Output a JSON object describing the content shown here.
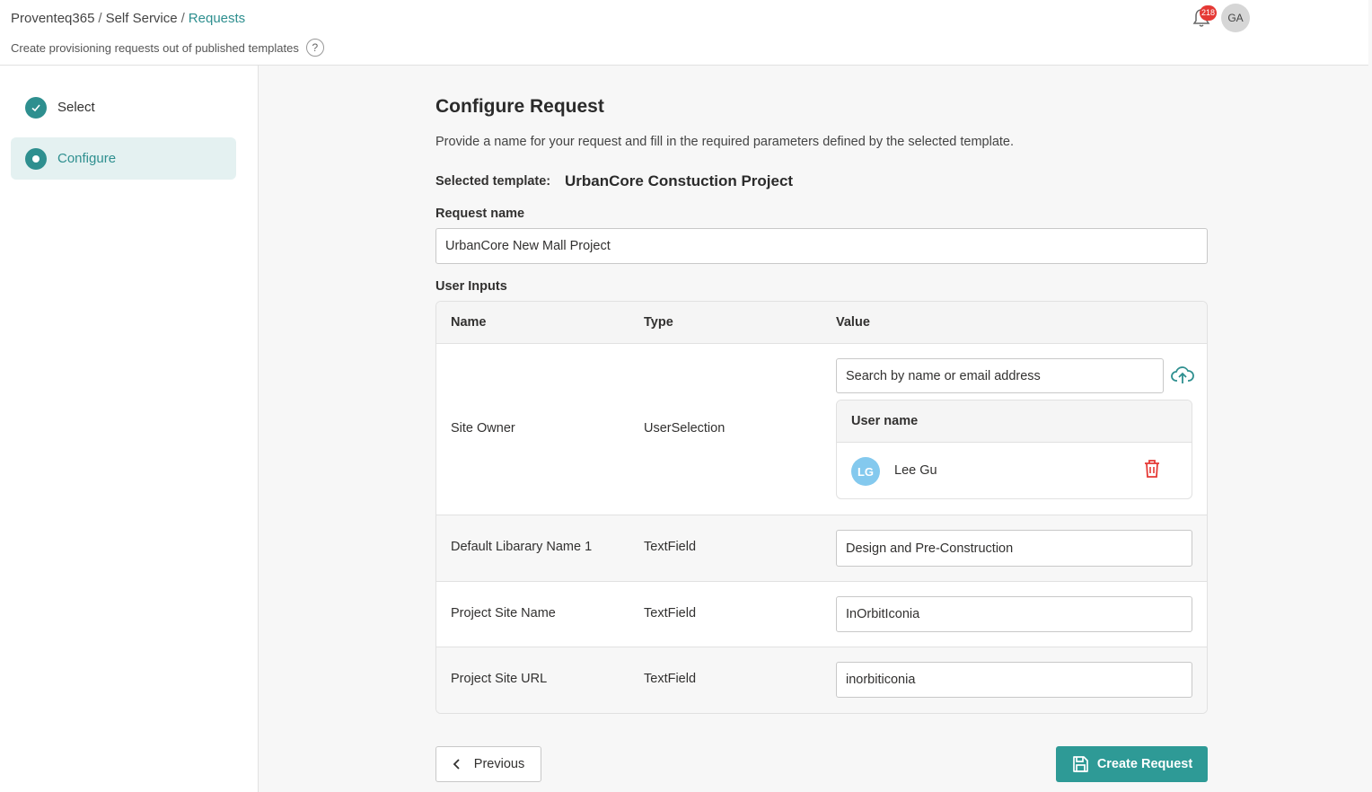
{
  "header": {
    "breadcrumb": [
      "Proventeq365",
      "Self Service",
      "Requests"
    ],
    "subtitle": "Create provisioning requests out of published templates",
    "help_icon": "?",
    "notification_count": "218",
    "user_initials": "GA"
  },
  "sidebar": {
    "steps": [
      {
        "label": "Select",
        "state": "completed"
      },
      {
        "label": "Configure",
        "state": "active"
      }
    ]
  },
  "main": {
    "title": "Configure Request",
    "description": "Provide a name for your request and fill in the required parameters defined by the selected template.",
    "selected_template_label": "Selected template:",
    "selected_template_value": "UrbanCore Constuction Project",
    "request_name_label": "Request name",
    "request_name_value": "UrbanCore New Mall Project",
    "user_inputs_label": "User Inputs",
    "table": {
      "headers": [
        "Name",
        "Type",
        "Value"
      ],
      "site_owner": {
        "name": "Site Owner",
        "type": "UserSelection",
        "search_placeholder": "Search by name or email address",
        "users_header": "User name",
        "users": [
          {
            "initials": "LG",
            "name": "Lee Gu"
          }
        ]
      },
      "rows": [
        {
          "name": "Default Libarary Name 1",
          "type": "TextField",
          "value": "Design and Pre-Construction"
        },
        {
          "name": "Project Site Name",
          "type": "TextField",
          "value": "InOrbitIconia"
        },
        {
          "name": "Project Site URL",
          "type": "TextField",
          "value": "inorbiticonia"
        }
      ]
    },
    "buttons": {
      "previous": "Previous",
      "create": "Create Request"
    }
  },
  "colors": {
    "accent": "#2e8f8f",
    "danger": "#e53935"
  }
}
